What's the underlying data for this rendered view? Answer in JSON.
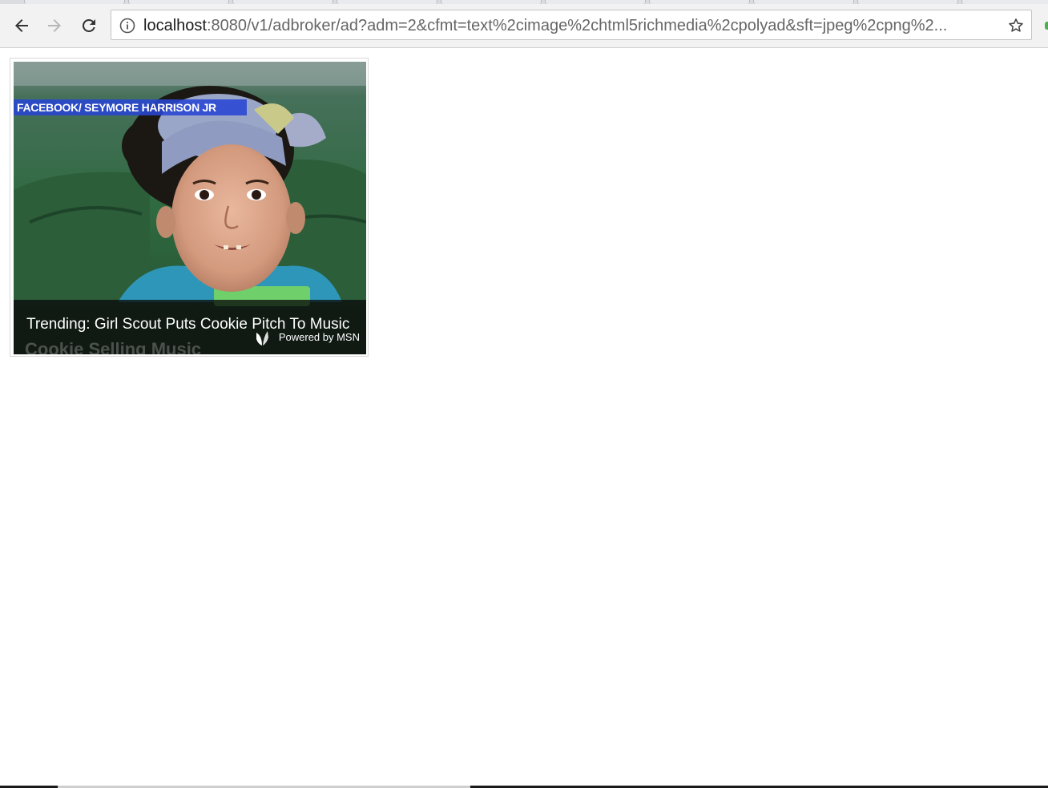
{
  "browser": {
    "url_host": "localhost",
    "url_rest": ":8080/v1/adbroker/ad?adm=2&cfmt=text%2cimage%2chtml5richmedia%2cpolyad&sft=jpeg%2cpng%2...",
    "icons": {
      "back": "arrow-left-icon",
      "forward": "arrow-right-icon",
      "reload": "reload-icon",
      "site_info": "info-icon",
      "bookmark": "star-icon"
    }
  },
  "ad": {
    "image_credit": "FACEBOOK/ SEYMORE HARRISON JR",
    "headline": "Trending: Girl Scout Puts Cookie Pitch To Music",
    "background_text": "Cookie Selling Music",
    "attribution": "Powered by MSN",
    "icons": {
      "brand": "msn-butterfly-icon"
    },
    "colors": {
      "credit_banner": "#2846d2",
      "caption_bg": "#0a0a0a"
    }
  }
}
